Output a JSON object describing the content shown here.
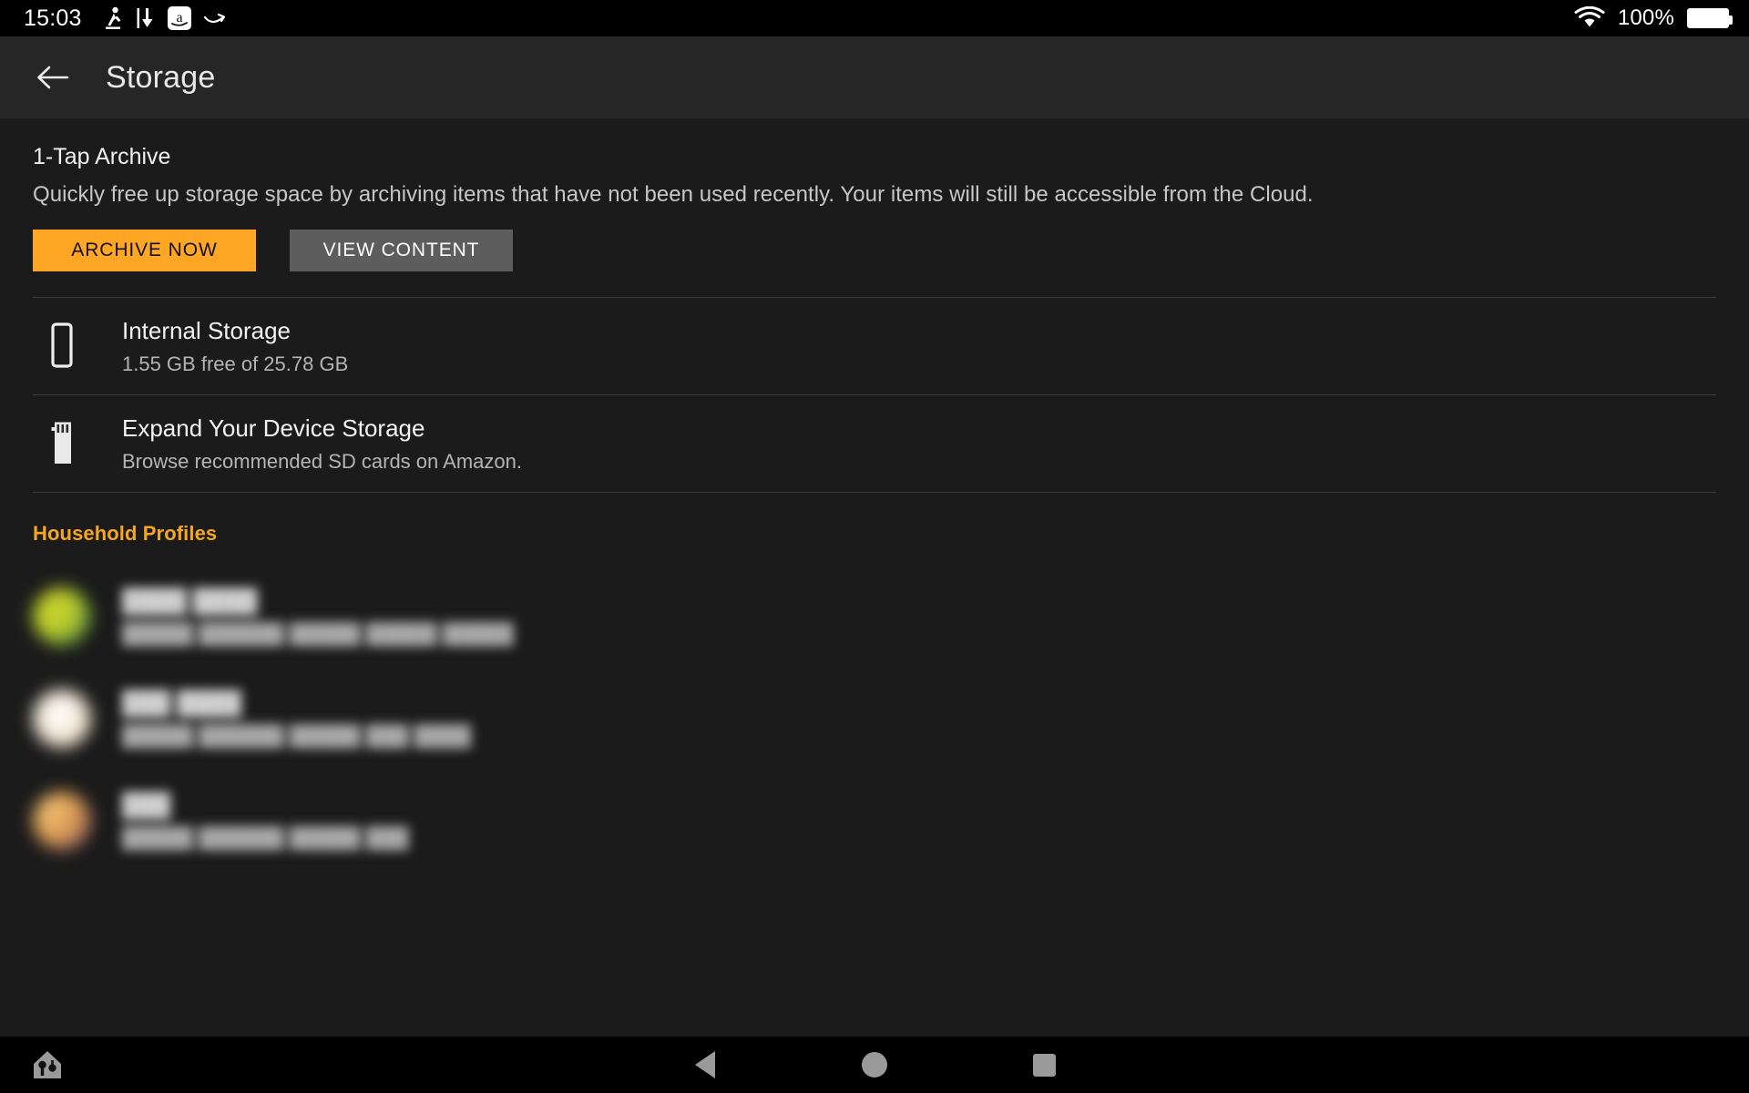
{
  "statusbar": {
    "time": "15:03",
    "icons": [
      "walking-person-icon",
      "download-icon",
      "amazon-app-icon",
      "swipe-gesture-icon"
    ],
    "battery_percent": "100%",
    "wifi": "wifi-icon"
  },
  "header": {
    "back": "back-arrow-icon",
    "title": "Storage"
  },
  "archive": {
    "title": "1-Tap Archive",
    "description": "Quickly free up storage space by archiving items that have not been used recently. Your items will still be accessible from the Cloud.",
    "primary_button": "ARCHIVE NOW",
    "secondary_button": "VIEW CONTENT"
  },
  "storage_rows": [
    {
      "icon": "phone-storage-icon",
      "title": "Internal Storage",
      "subtitle": "1.55 GB free of 25.78 GB"
    },
    {
      "icon": "sd-card-icon",
      "title": "Expand Your Device Storage",
      "subtitle": "Browse recommended SD cards on Amazon."
    }
  ],
  "household": {
    "header": "Household Profiles",
    "profiles": [
      {
        "name": "████ ████",
        "subtitle": "█████ ██████ █████ █████ █████",
        "avatar_color_a": "#c9d62e",
        "avatar_color_b": "#4f8a46"
      },
      {
        "name": "███ ████",
        "subtitle": "█████ ██████ █████ ███ ████",
        "avatar_color_a": "#f3ead9",
        "avatar_color_b": "#d8c6ae"
      },
      {
        "name": "███",
        "subtitle": "█████ ██████ █████ ███",
        "avatar_color_a": "#e0a252",
        "avatar_color_b": "#8d5a60"
      }
    ]
  },
  "navbar": {
    "home": "household-home-icon",
    "back": "nav-back-icon",
    "circle": "nav-home-icon",
    "square": "nav-recents-icon"
  },
  "colors": {
    "accent_orange": "#FFA724",
    "household_label": "#F5A623",
    "header_bg": "#262626",
    "content_bg": "#1b1b1b",
    "statusbar_bg": "#000000",
    "secondary_button": "#5d5d5d"
  }
}
